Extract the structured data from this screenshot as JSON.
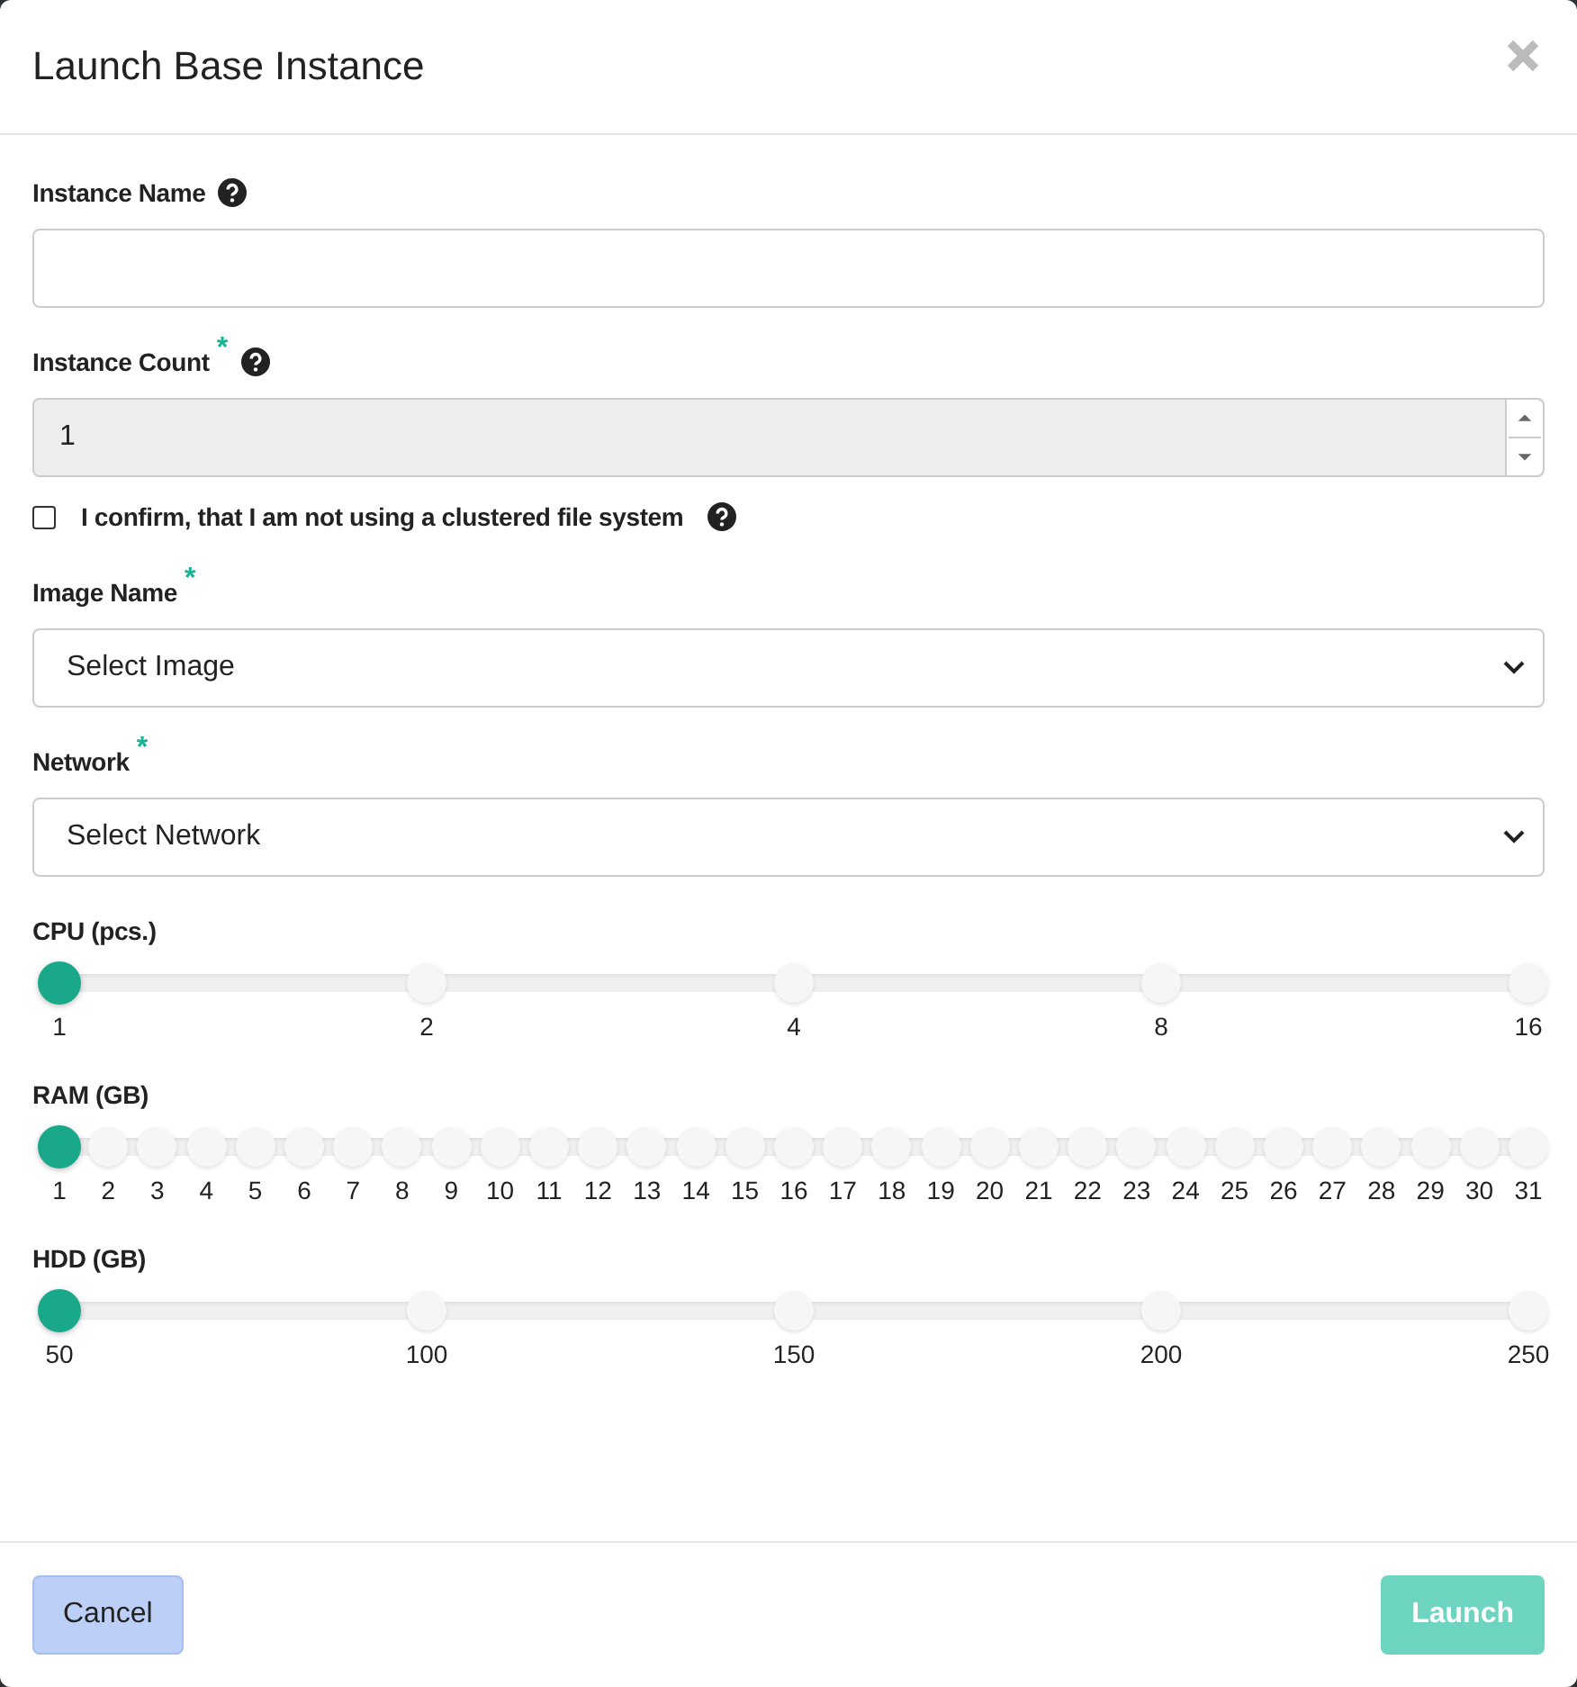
{
  "dialog": {
    "title": "Launch Base Instance"
  },
  "fields": [
    {
      "kind": "text",
      "label": "Instance Name",
      "help": true
    },
    {
      "kind": "number",
      "label": "Instance Count",
      "required_mark": "*",
      "help": true,
      "value": "1",
      "disabled": true
    },
    {
      "kind": "checkbox",
      "label": "I confirm, that I am not using a clustered file system",
      "checked": false,
      "help": true
    },
    {
      "kind": "select",
      "label": "Image Name",
      "required_mark": "*",
      "value": "Select Image"
    },
    {
      "kind": "select",
      "label": "Network",
      "required_mark": "*",
      "value": "Select Network"
    },
    {
      "kind": "slider",
      "label": "CPU (pcs.)",
      "level": 0,
      "ticks": [
        "1",
        "2",
        "4",
        "8",
        "16"
      ]
    },
    {
      "kind": "slider",
      "label": "RAM (GB)",
      "level": 0,
      "ticks": [
        "1",
        "2",
        "3",
        "4",
        "5",
        "6",
        "7",
        "8",
        "9",
        "10",
        "11",
        "12",
        "13",
        "14",
        "15",
        "16",
        "17",
        "18",
        "19",
        "20",
        "21",
        "22",
        "23",
        "24",
        "25",
        "26",
        "27",
        "28",
        "29",
        "30",
        "31"
      ]
    },
    {
      "kind": "slider",
      "label": "HDD (GB)",
      "level": 0,
      "ticks": [
        "50",
        "100",
        "150",
        "200",
        "250"
      ]
    }
  ],
  "buttons": [
    {
      "label": "Cancel",
      "kind": "secondary",
      "disabled": false
    },
    {
      "label": "Launch",
      "kind": "primary",
      "disabled": true
    }
  ]
}
